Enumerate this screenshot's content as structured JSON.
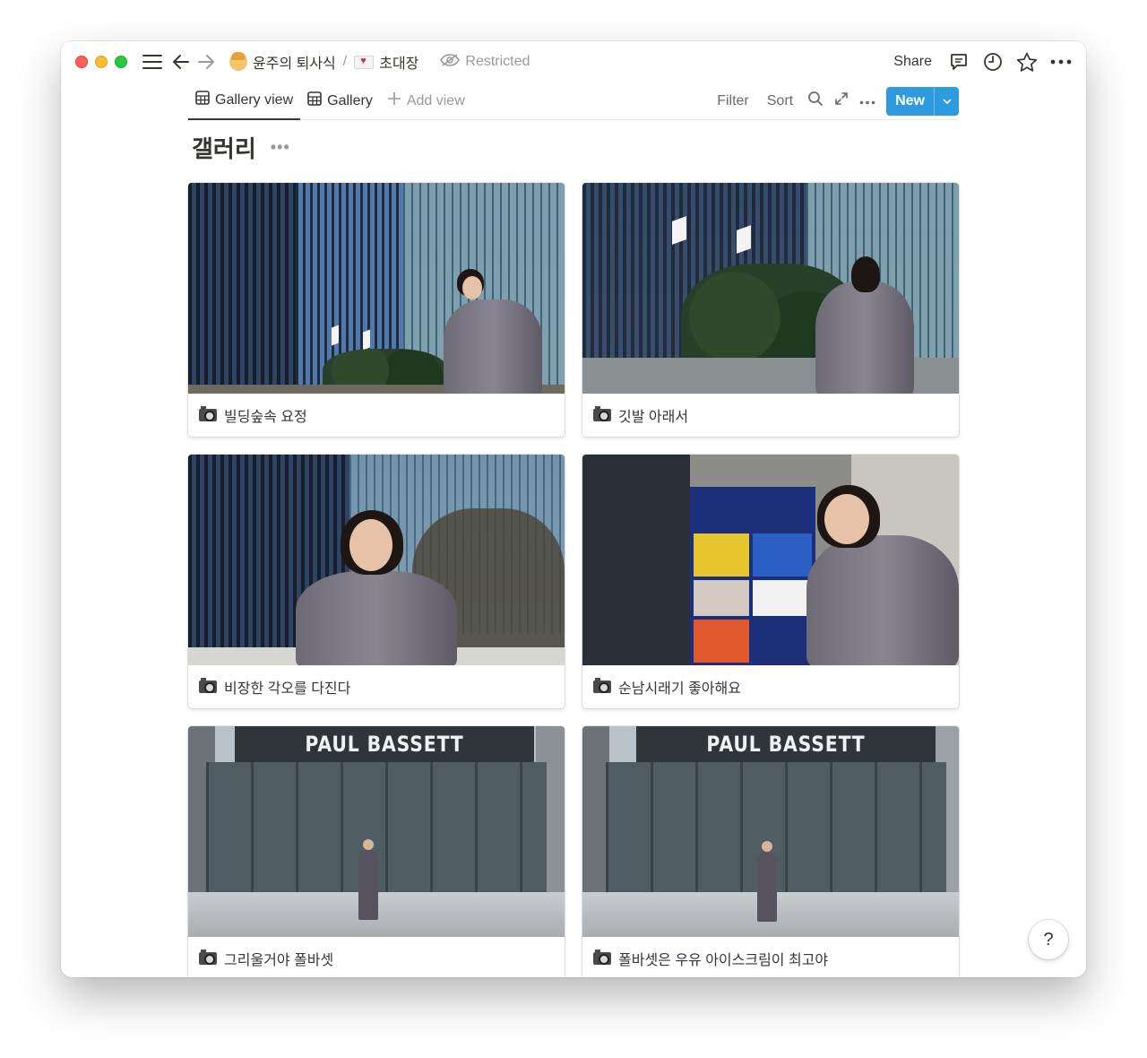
{
  "titlebar": {
    "breadcrumbs": [
      {
        "label": "윤주의 퇴사식",
        "icon": "person-emoji-icon"
      },
      {
        "label": "초대장",
        "icon": "love-letter-emoji-icon"
      }
    ],
    "separator": "/",
    "restricted_label": "Restricted",
    "share_label": "Share"
  },
  "viewbar": {
    "tabs": [
      {
        "label": "Gallery view",
        "active": true
      },
      {
        "label": "Gallery",
        "active": false
      }
    ],
    "add_view_label": "Add view",
    "filter_label": "Filter",
    "sort_label": "Sort",
    "new_label": "New"
  },
  "page": {
    "title": "갤러리",
    "more_label": "•••"
  },
  "gallery": {
    "cards": [
      {
        "caption": "빌딩숲속 요정"
      },
      {
        "caption": "깃발 아래서"
      },
      {
        "caption": "비장한 각오를 다진다"
      },
      {
        "caption": "순남시래기 좋아해요"
      },
      {
        "caption": "그리울거야 폴바셋"
      },
      {
        "caption": "폴바셋은 우유 아이스크림이 최고야"
      }
    ],
    "store_sign": "PAUL BASSETT"
  },
  "help_label": "?",
  "colors": {
    "accent": "#2e9be0",
    "text": "#37352f",
    "muted": "#9b9a97"
  }
}
